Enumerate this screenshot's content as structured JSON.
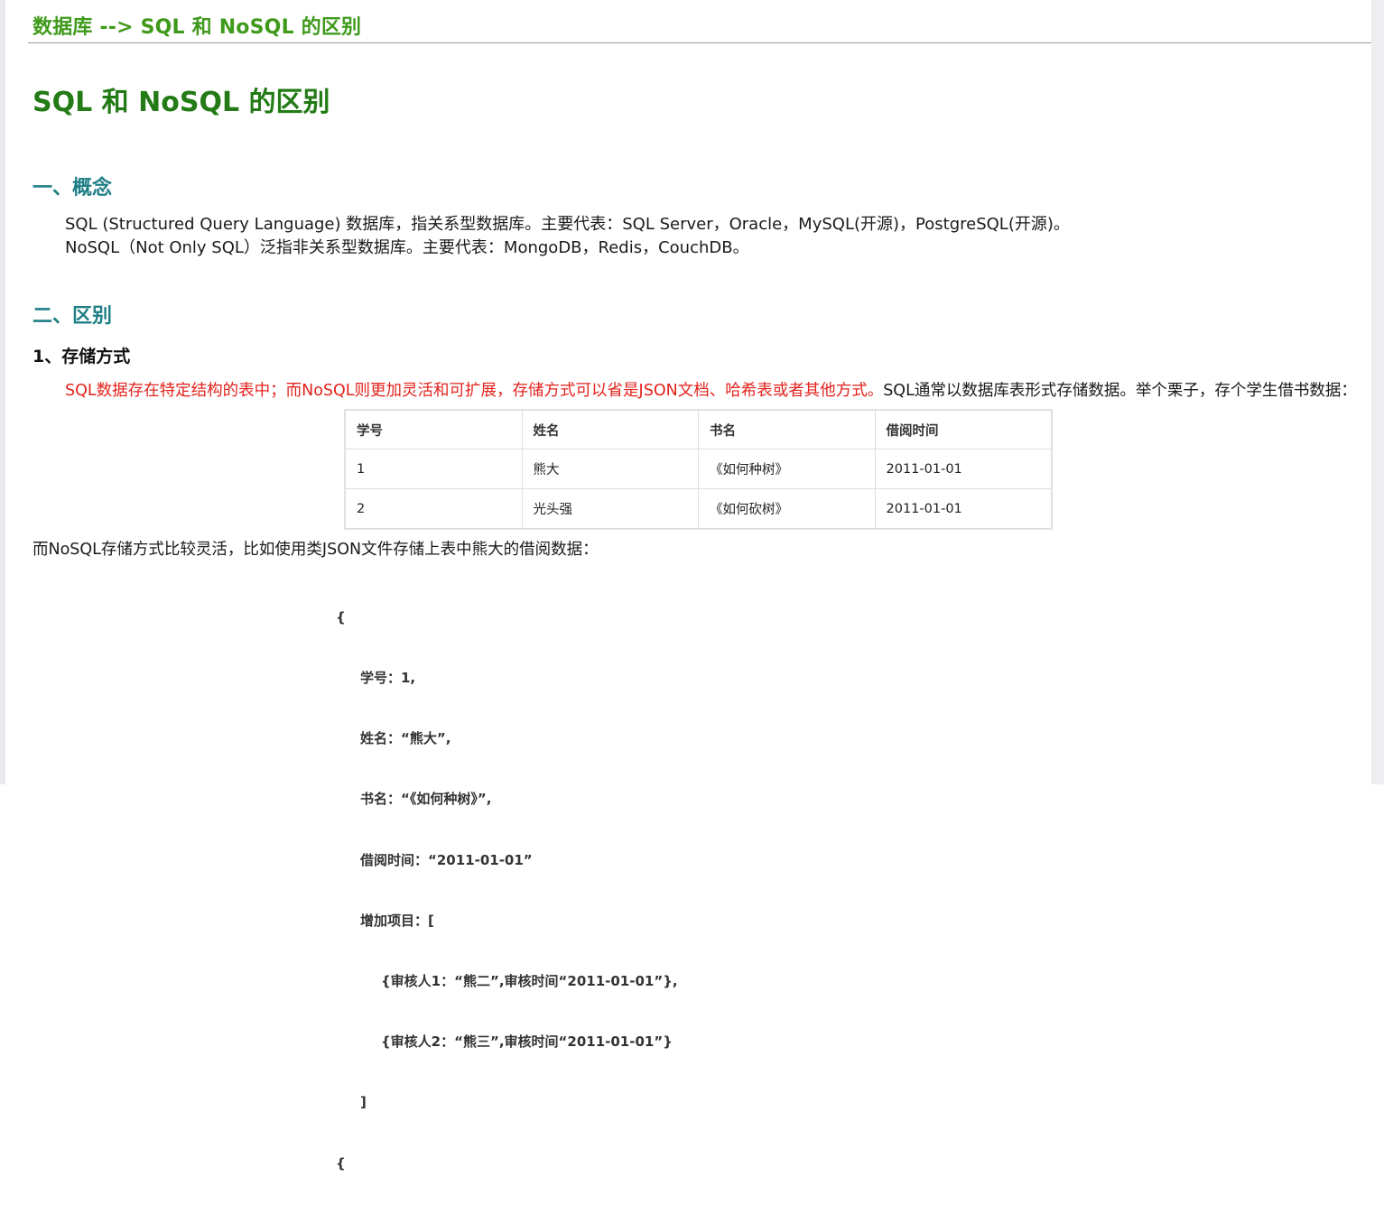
{
  "header": {
    "title": "数据库 --> SQL 和 NoSQL 的区别"
  },
  "article": {
    "title": "SQL 和 NoSQL 的区别",
    "sections": [
      {
        "heading": "一、概念",
        "paragraphs": [
          "SQL (Structured Query Language) 数据库，指关系型数据库。主要代表：SQL Server，Oracle，MySQL(开源)，PostgreSQL(开源)。",
          "NoSQL（Not Only SQL）泛指非关系型数据库。主要代表：MongoDB，Redis，CouchDB。"
        ]
      },
      {
        "heading": "二、区别",
        "subheading": "1、存储方式",
        "intro_red": "SQL数据存在特定结构的表中；而NoSQL则更加灵活和可扩展，存储方式可以省是JSON文档、哈希表或者其他方式。",
        "intro_black": "SQL通常以数据库表形式存储数据。举个栗子，存个学生借书数据：",
        "after_table": "而NoSQL存储方式比较灵活，比如使用类JSON文件存储上表中熊大的借阅数据："
      }
    ]
  },
  "table": {
    "headers": [
      "学号",
      "姓名",
      "书名",
      "借阅时间"
    ],
    "rows": [
      [
        "1",
        "熊大",
        "《如何种树》",
        "2011-01-01"
      ],
      [
        "2",
        "光头强",
        "《如何砍树》",
        "2011-01-01"
      ]
    ]
  },
  "json_example": {
    "lines": [
      "{",
      "学号：1,",
      "姓名：“熊大”,",
      "书名：“《如何种树》”,",
      "借阅时间：“2011-01-01”",
      "增加项目：[",
      "{审核人1：“熊二”,审核时间“2011-01-01”},",
      "{审核人2：“熊三”,审核时间“2011-01-01”}",
      "]",
      "{"
    ]
  },
  "colors": {
    "header_green": "#3f9a1b",
    "title_green": "#237b16",
    "section_teal": "#1f7f86",
    "highlight_red": "#e3221c"
  }
}
